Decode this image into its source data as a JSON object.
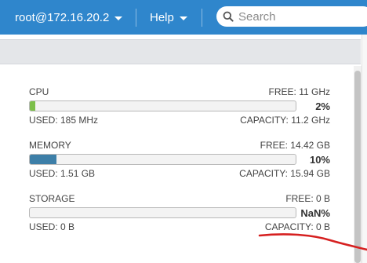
{
  "header": {
    "user_menu_label": "root@172.16.20.2",
    "help_menu_label": "Help",
    "search_placeholder": "Search"
  },
  "resources": [
    {
      "name": "CPU",
      "free": "FREE: 11 GHz",
      "used": "USED: 185 MHz",
      "capacity": "CAPACITY: 11.2 GHz",
      "percent_label": "2%",
      "fill_percent": 2,
      "fill_color": "#7cbf4a"
    },
    {
      "name": "MEMORY",
      "free": "FREE: 14.42 GB",
      "used": "USED: 1.51 GB",
      "capacity": "CAPACITY: 15.94 GB",
      "percent_label": "10%",
      "fill_percent": 10,
      "fill_color": "#3d7fa8"
    },
    {
      "name": "STORAGE",
      "free": "FREE: 0 B",
      "used": "USED: 0 B",
      "capacity": "CAPACITY: 0 B",
      "percent_label": "NaN%",
      "fill_percent": 0,
      "fill_color": "#3d7fa8"
    }
  ],
  "colors": {
    "header_bg": "#2f86cc",
    "annotation_stroke": "#d62020"
  }
}
